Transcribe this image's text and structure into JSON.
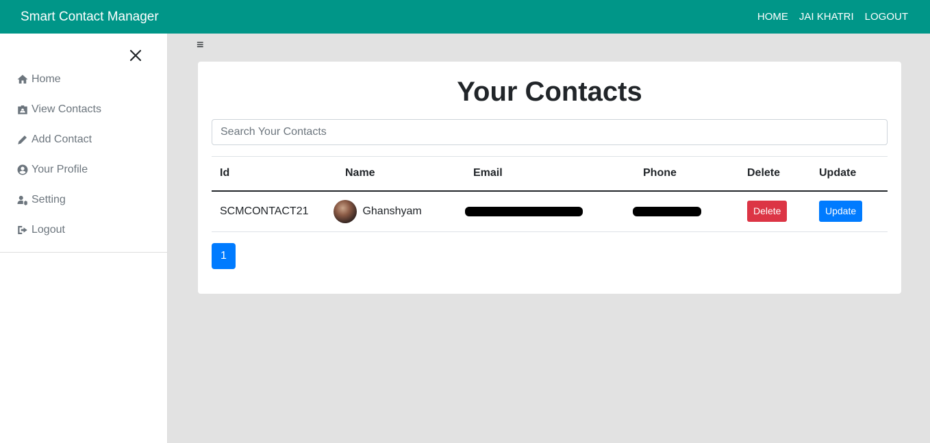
{
  "navbar": {
    "brand": "Smart Contact Manager",
    "links": [
      "HOME",
      "JAI KHATRI",
      "LOGOUT"
    ],
    "color": "#009688"
  },
  "sidebar": {
    "items": [
      {
        "label": "Home",
        "icon": "home-icon"
      },
      {
        "label": "View Contacts",
        "icon": "id-badge-icon"
      },
      {
        "label": "Add Contact",
        "icon": "pencil-icon"
      },
      {
        "label": "Your Profile",
        "icon": "user-circle-icon"
      },
      {
        "label": "Setting",
        "icon": "user-cog-icon"
      },
      {
        "label": "Logout",
        "icon": "sign-out-icon"
      }
    ]
  },
  "main": {
    "title": "Your Contacts",
    "search_placeholder": "Search Your Contacts",
    "table": {
      "headers": [
        "Id",
        "Name",
        "Email",
        "Phone",
        "Delete",
        "Update"
      ],
      "rows": [
        {
          "id": "SCMCONTACT21",
          "name": "Ghanshyam",
          "email": "[redacted]",
          "phone": "[redacted]",
          "delete": "Delete",
          "update": "Update"
        }
      ]
    },
    "pagination": {
      "current_page": "1"
    }
  },
  "colors": {
    "delete": "#dc3545",
    "update": "#007bff",
    "page_active": "#007bff"
  }
}
